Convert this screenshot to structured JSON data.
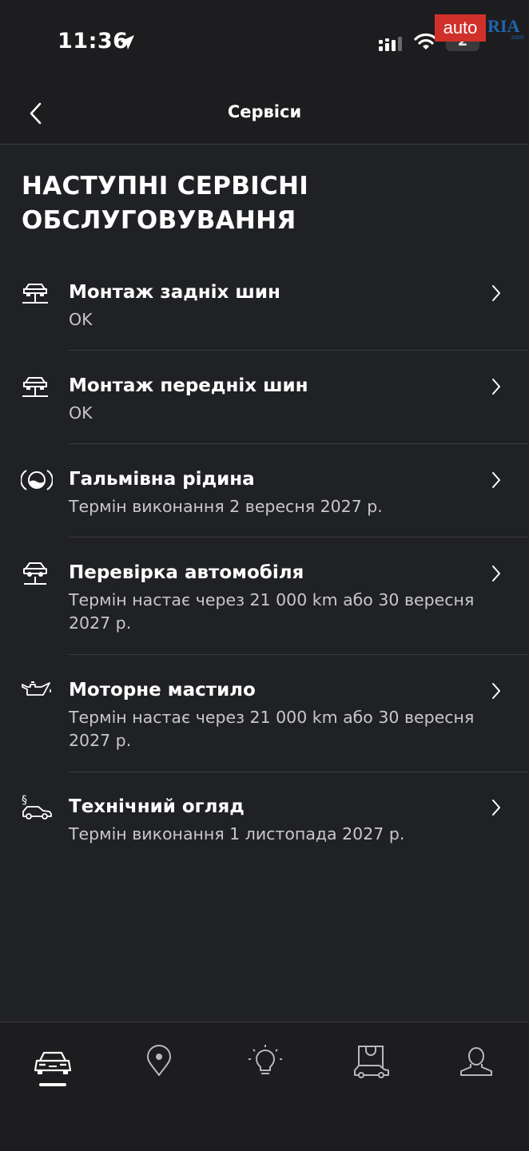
{
  "status_bar": {
    "time": "11:36",
    "battery": "2"
  },
  "watermark": {
    "auto": "auto",
    "ria": "RIA",
    "com": ".com"
  },
  "nav": {
    "title": "Сервіси"
  },
  "section": {
    "title": "НАСТУПНІ СЕРВІСНІ ОБСЛУГОВУВАННЯ"
  },
  "services": [
    {
      "icon": "tire-lift-icon",
      "title": "Монтаж задніх шин",
      "subtitle": "OK"
    },
    {
      "icon": "tire-lift-icon",
      "title": "Монтаж передніх шин",
      "subtitle": "OK"
    },
    {
      "icon": "brake-fluid-icon",
      "title": "Гальмівна рідина",
      "subtitle": "Термін виконання 2 вересня 2027 р."
    },
    {
      "icon": "car-lift-icon",
      "title": "Перевірка автомобіля",
      "subtitle": "Термін настає через 21 000 km або 30 вересня 2027 р."
    },
    {
      "icon": "oil-can-icon",
      "title": "Моторне мастило",
      "subtitle": "Термін настає через 21 000 km або 30 вересня 2027 р."
    },
    {
      "icon": "inspection-icon",
      "title": "Технічний огляд",
      "subtitle": "Термін виконання 1 листопада 2027 р."
    }
  ],
  "tabs": [
    {
      "icon": "car-icon",
      "active": true
    },
    {
      "icon": "map-pin-icon",
      "active": false
    },
    {
      "icon": "lightbulb-icon",
      "active": false
    },
    {
      "icon": "shop-icon",
      "active": false
    },
    {
      "icon": "profile-icon",
      "active": false
    }
  ],
  "colors": {
    "background": "#202124",
    "bars": "#1d1d1f",
    "text": "#ffffff",
    "subtext": "#c8c8cc",
    "divider": "#3c3c3f"
  }
}
